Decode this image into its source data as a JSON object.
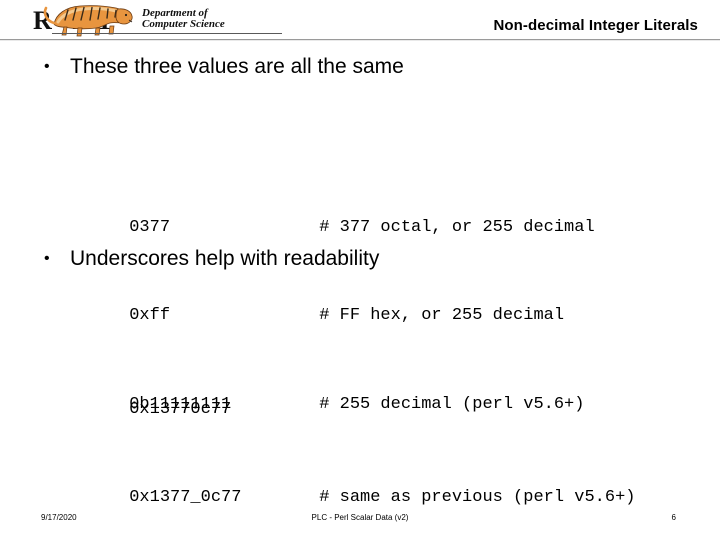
{
  "header": {
    "logo": {
      "mark": "RIT",
      "dept_line1": "Department of",
      "dept_line2": "Computer Science",
      "icon": "rit-tiger-logo"
    },
    "title": "Non-decimal Integer Literals"
  },
  "slide": {
    "bullets": [
      {
        "marker": "•",
        "text": "These three values are all the same"
      },
      {
        "marker": "•",
        "text": "Underscores help with readability"
      }
    ],
    "code_block_1": [
      {
        "literal": "0377",
        "comment": "# 377 octal, or 255 decimal"
      },
      {
        "literal": "0xff",
        "comment": "# FF hex, or 255 decimal"
      },
      {
        "literal": "0b11111111",
        "comment": "# 255 decimal (perl v5.6+)"
      }
    ],
    "code_block_2": [
      {
        "literal": "0x13770c77",
        "comment": ""
      },
      {
        "literal": "0x1377_0c77",
        "comment": "# same as previous (perl v5.6+)"
      }
    ]
  },
  "footer": {
    "date": "9/17/2020",
    "center": "PLC - Perl Scalar Data (v2)",
    "page": "6"
  },
  "colors": {
    "background": "#ffffff",
    "text": "#000000",
    "rule": "#9a9a9a",
    "tiger_body": "#e8953f",
    "tiger_stripe": "#2b2119",
    "tiger_light": "#f3c88d"
  }
}
